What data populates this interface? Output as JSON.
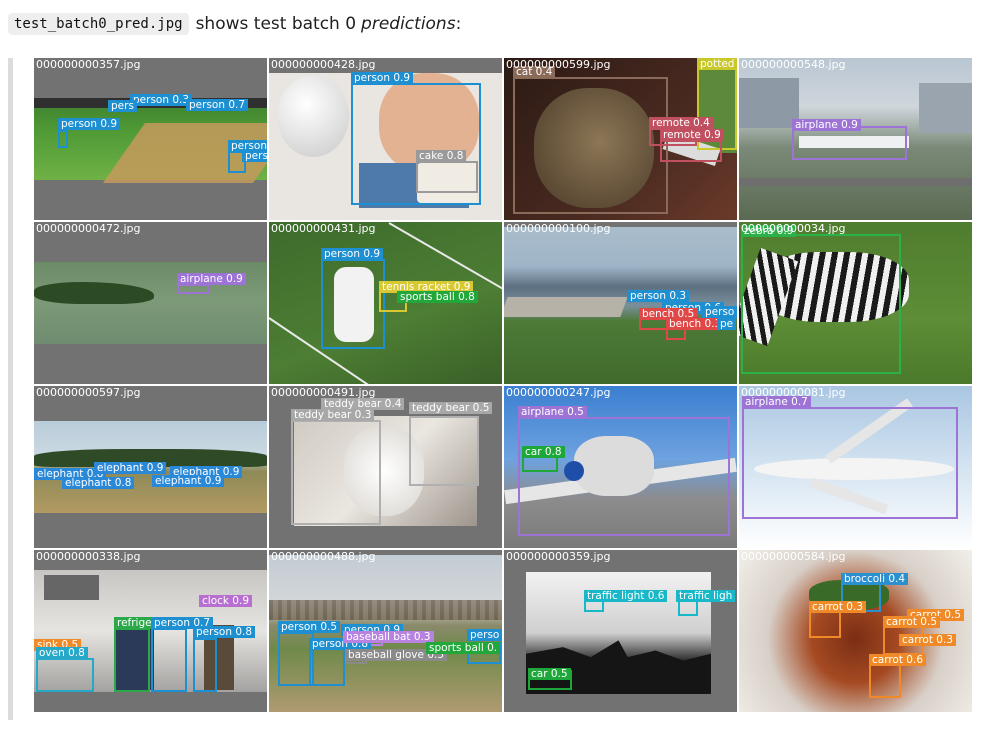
{
  "caption": {
    "filename": "test_batch0_pred.jpg",
    "text": "shows test batch 0",
    "emphasis": "predictions",
    "suffix": ":"
  },
  "tiles": [
    {
      "filename": "000000000357.jpg",
      "detections": [
        "person 0.3",
        "person 0.7",
        "person 0.9",
        "person",
        "pers",
        "pers"
      ]
    },
    {
      "filename": "000000000428.jpg",
      "detections": [
        "person 0.9",
        "cake 0.8"
      ]
    },
    {
      "filename": "000000000599.jpg",
      "detections": [
        "cat 0.4",
        "potted",
        "remote 0.4",
        "remote 0.9"
      ]
    },
    {
      "filename": "000000000548.jpg",
      "detections": [
        "airplane 0.9"
      ]
    },
    {
      "filename": "000000000472.jpg",
      "detections": [
        "airplane 0.9"
      ]
    },
    {
      "filename": "000000000431.jpg",
      "detections": [
        "person 0.9",
        "tennis racket 0.9",
        "sports ball 0.8"
      ]
    },
    {
      "filename": "000000000100.jpg",
      "detections": [
        "person 0.3",
        "person 0.6",
        "perso",
        "bench 0.5",
        "bench 0.3",
        "pe"
      ]
    },
    {
      "filename": "000000000034.jpg",
      "detections": [
        "zebra 0.9"
      ]
    },
    {
      "filename": "000000000597.jpg",
      "detections": [
        "elephant 0.8",
        "elephant 0.9",
        "elephant 0.9",
        "elephant 0.8",
        "elephant 0.9"
      ]
    },
    {
      "filename": "000000000491.jpg",
      "detections": [
        "teddy bear 0.4",
        "teddy bear 0.5",
        "teddy bear 0.3"
      ]
    },
    {
      "filename": "000000000247.jpg",
      "detections": [
        "airplane 0.5",
        "car 0.8"
      ]
    },
    {
      "filename": "000000000081.jpg",
      "detections": [
        "airplane 0.7"
      ]
    },
    {
      "filename": "000000000338.jpg",
      "detections": [
        "clock 0.9",
        "refrige",
        "person 0.7",
        "person 0.8",
        "sink 0.5",
        "oven 0.8"
      ]
    },
    {
      "filename": "000000000488.jpg",
      "detections": [
        "person 0.5",
        "person 0.8",
        "baseball bat 0.3",
        "person 0.9",
        "baseball glove 0.5",
        "sports ball 0.",
        "perso"
      ]
    },
    {
      "filename": "000000000359.jpg",
      "detections": [
        "traffic light 0.6",
        "traffic ligh",
        "car 0.5"
      ]
    },
    {
      "filename": "000000000584.jpg",
      "detections": [
        "broccoli 0.4",
        "carrot 0.3",
        "carrot 0.5",
        "carrot 0.5",
        "carrot 0.3",
        "carrot 0.6"
      ]
    }
  ]
}
